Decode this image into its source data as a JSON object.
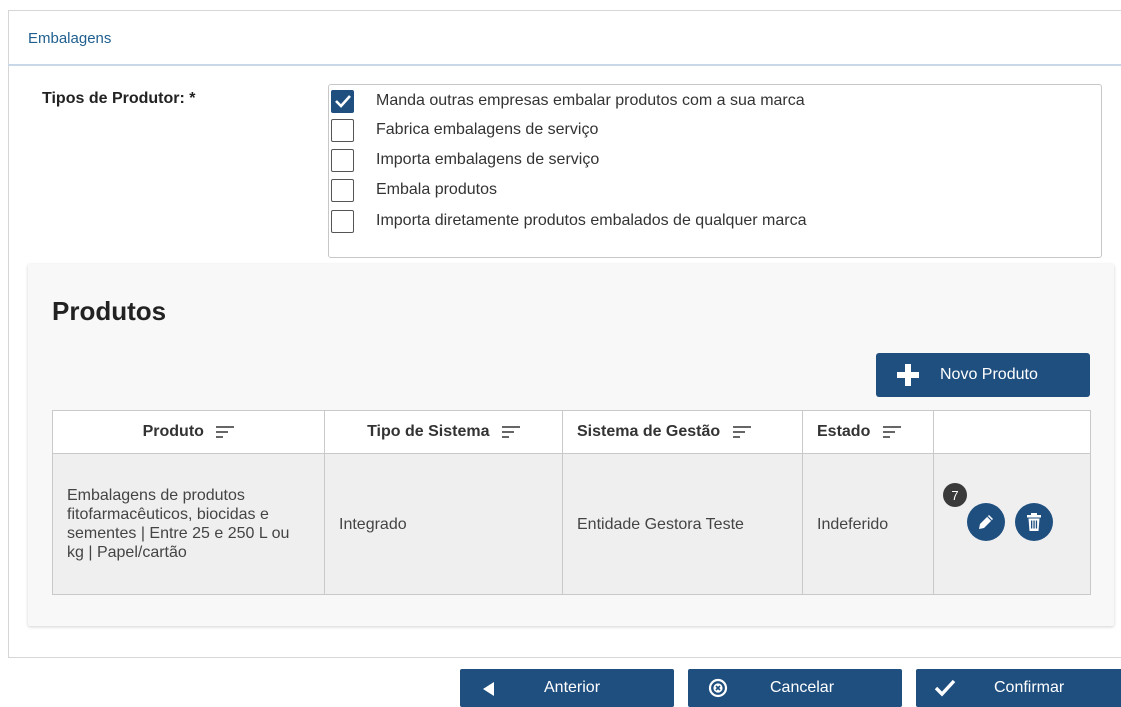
{
  "tabs": [
    {
      "label": "Embalagens"
    }
  ],
  "tipos_produtor": {
    "label": "Tipos de Produtor: *",
    "options": [
      {
        "label": "Manda outras empresas embalar produtos com a sua marca",
        "checked": true
      },
      {
        "label": "Fabrica embalagens de serviço",
        "checked": false
      },
      {
        "label": "Importa embalagens de serviço",
        "checked": false
      },
      {
        "label": "Embala produtos",
        "checked": false
      },
      {
        "label": "Importa diretamente produtos embalados de qualquer marca",
        "checked": false
      }
    ]
  },
  "produtos": {
    "title": "Produtos",
    "new_button_label": "Novo Produto",
    "columns": [
      "Produto",
      "Tipo de Sistema",
      "Sistema de Gestão",
      "Estado"
    ],
    "rows": [
      {
        "produto": "Embalagens de produtos fitofarmacêuticos, biocidas e sementes | Entre 25 e 250 L ou kg | Papel/cartão",
        "tipo_sistema": "Integrado",
        "sistema_gestao": "Entidade Gestora Teste",
        "estado": "Indeferido",
        "badge": "7"
      }
    ]
  },
  "footer": {
    "anterior_label": "Anterior",
    "cancelar_label": "Cancelar",
    "confirmar_label": "Confirmar"
  },
  "colors": {
    "accent": "#1f4f7f",
    "tab_text": "#1f5f8f"
  },
  "icons": [
    "check-icon",
    "plus-icon",
    "sort-icon",
    "edit-pencil-icon",
    "trash-icon",
    "arrow-left-icon",
    "cancel-circle-icon"
  ]
}
